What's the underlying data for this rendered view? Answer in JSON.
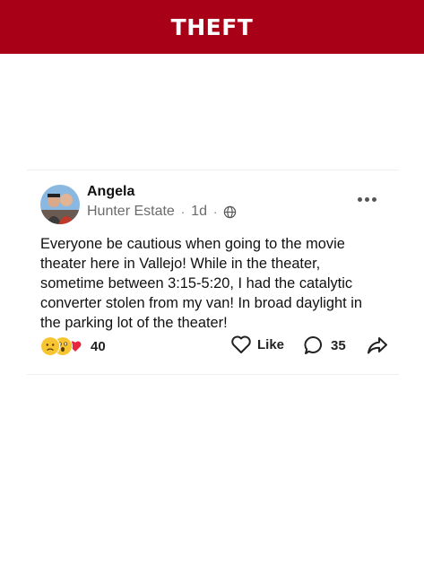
{
  "banner": {
    "title": "THEFT"
  },
  "post": {
    "author": "Angela",
    "neighborhood": "Hunter Estate",
    "separator": "·",
    "time": "1d",
    "text": "Everyone be cautious when going to the movie theater here in Vallejo! While in the theater, sometime between 3:15-5:20, I had the catalytic converter stolen from my van! In broad daylight in the parking lot of the theater!",
    "reaction_count": "40",
    "like_label": "Like",
    "comment_count": "35"
  },
  "icons": {
    "audience": "globe-icon",
    "options": "more-horizontal-icon",
    "reactions": [
      "sad-emoji-icon",
      "shocked-emoji-icon",
      "heart-icon"
    ],
    "like": "heart-outline-icon",
    "comment": "speech-bubble-icon",
    "share": "share-arrow-icon"
  },
  "colors": {
    "banner": "#a80016",
    "text": "#111111",
    "meta": "#6b6b6b",
    "heart": "#e8253f"
  }
}
